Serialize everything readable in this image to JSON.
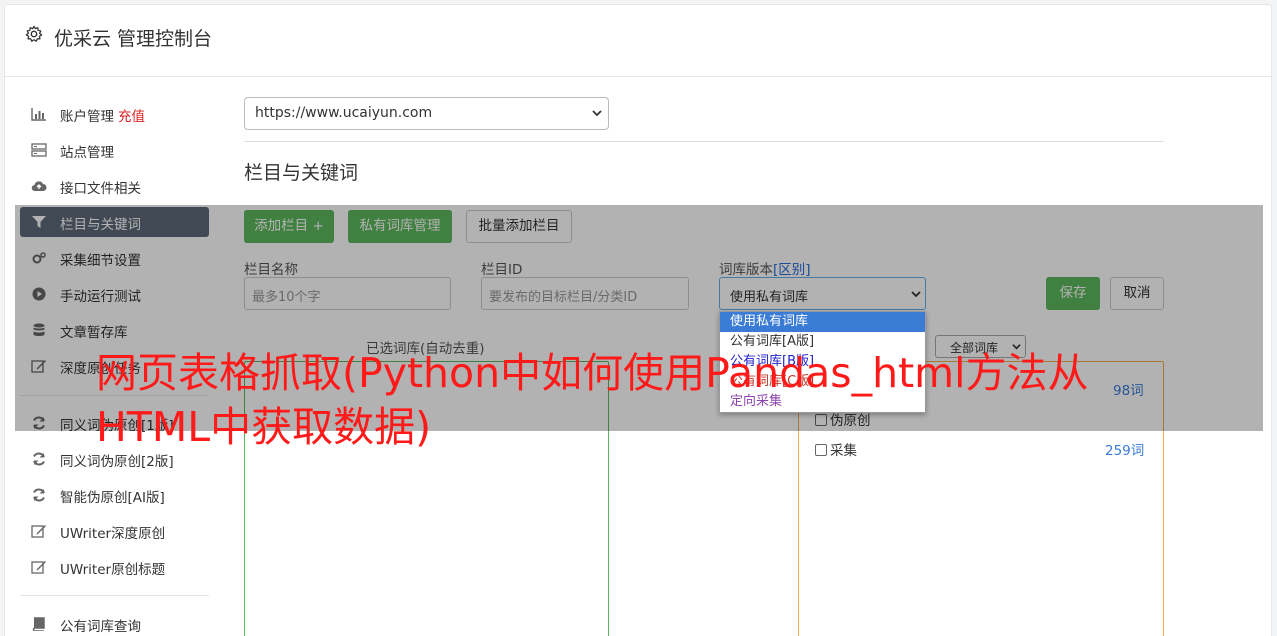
{
  "header": {
    "title": "优采云 管理控制台"
  },
  "sidebar": {
    "items": [
      {
        "label": "账户管理",
        "extra": "充值"
      },
      {
        "label": "站点管理"
      },
      {
        "label": "接口文件相关"
      },
      {
        "label": "栏目与关键词"
      },
      {
        "label": "采集细节设置"
      },
      {
        "label": "手动运行测试"
      },
      {
        "label": "文章暂存库"
      },
      {
        "label": "深度原创任务"
      },
      {
        "label": "同义词伪原创[1版]"
      },
      {
        "label": "同义词伪原创[2版]"
      },
      {
        "label": "智能伪原创[AI版]"
      },
      {
        "label": "UWriter深度原创"
      },
      {
        "label": "UWriter原创标题"
      },
      {
        "label": "公有词库查询"
      }
    ]
  },
  "main": {
    "site_select": "https://www.ucaiyun.com",
    "section_title": "栏目与关键词",
    "buttons": {
      "add_column": "添加栏目 +",
      "private_lib": "私有词库管理",
      "batch_add": "批量添加栏目"
    },
    "form": {
      "name_label": "栏目名称",
      "name_placeholder": "最多10个字",
      "id_label": "栏目ID",
      "id_placeholder": "要发布的目标栏目/分类ID",
      "version_label": "词库版本",
      "version_label_link": "[区别]",
      "version_value": "使用私有词库",
      "save": "保存",
      "cancel": "取消"
    },
    "version_options": [
      "使用私有词库",
      "公有词库[A版]",
      "公有词库[B版]",
      "公有词库[C版]",
      "定向采集"
    ],
    "selected_label": "已选词库(自动去重)",
    "filter_value": "全部词库",
    "keywords": [
      {
        "name": "",
        "count": "98词"
      },
      {
        "name": "伪原创",
        "count": ""
      },
      {
        "name": "采集",
        "count": "259词"
      }
    ]
  },
  "watermark": "网页表格抓取(Python中如何使用Pandas_html方法从HTML中获取数据)",
  "colors": {
    "green": "#5cb85c",
    "active_nav": "#5d6b79",
    "link_blue": "#3a7bd5",
    "red": "#e02020"
  }
}
